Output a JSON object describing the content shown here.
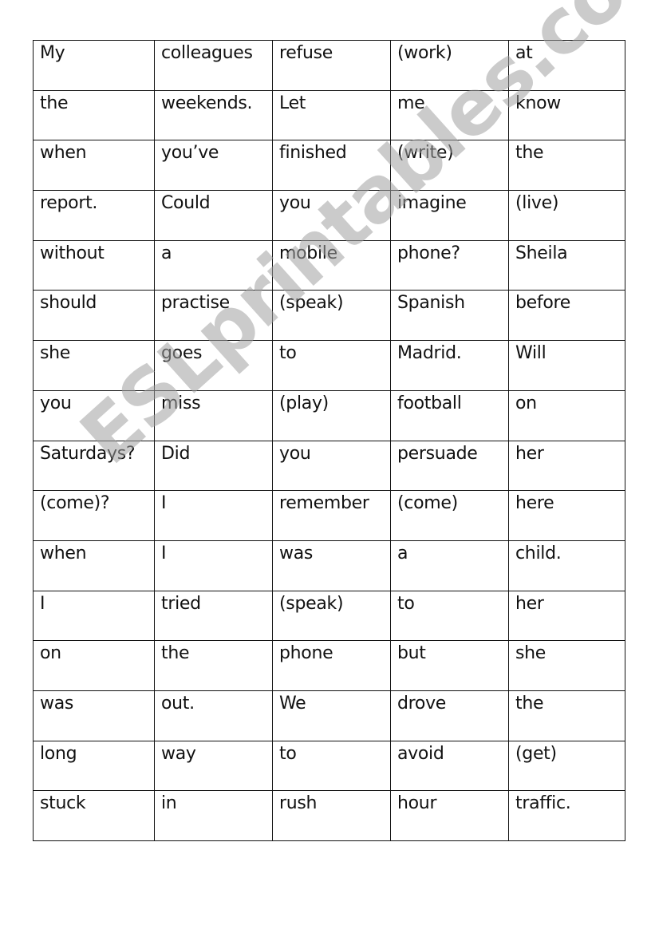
{
  "worksheet": {
    "rows": [
      [
        "My",
        "colleagues",
        "refuse",
        "(work)",
        "at"
      ],
      [
        "the",
        "weekends.",
        "Let",
        "me",
        "know"
      ],
      [
        "when",
        "you’ve",
        "finished",
        "(write)",
        "the"
      ],
      [
        "report.",
        "Could",
        "you",
        "imagine",
        "(live)"
      ],
      [
        "without",
        "a",
        "mobile",
        "phone?",
        "Sheila"
      ],
      [
        "should",
        "practise",
        "(speak)",
        "Spanish",
        "before"
      ],
      [
        "she",
        "goes",
        "to",
        "Madrid.",
        "Will"
      ],
      [
        "you",
        "miss",
        "(play)",
        "football",
        "on"
      ],
      [
        "Saturdays?",
        "Did",
        "you",
        "persuade",
        "her"
      ],
      [
        "(come)?",
        "I",
        "remember",
        "(come)",
        "here"
      ],
      [
        "when",
        "I",
        "was",
        "a",
        "child."
      ],
      [
        "I",
        "tried",
        "(speak)",
        "to",
        "her"
      ],
      [
        "on",
        "the",
        "phone",
        "but",
        "she"
      ],
      [
        "was",
        "out.",
        "We",
        "drove",
        "the"
      ],
      [
        "long",
        "way",
        "to",
        "avoid",
        "(get)"
      ],
      [
        "stuck",
        "in",
        "rush",
        "hour",
        "traffic."
      ]
    ]
  },
  "watermark": {
    "text": "ESLprintables.com"
  }
}
